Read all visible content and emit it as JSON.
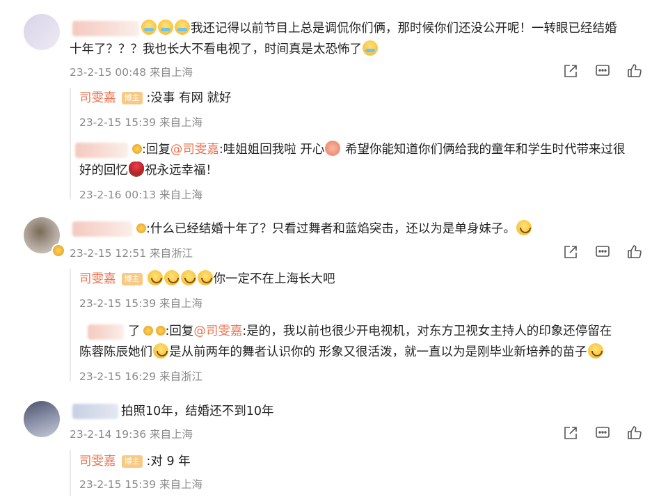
{
  "comments": [
    {
      "text_line1": "我还记得以前节目上总是调侃你们俩，那时候你们还没公开呢！一转眼已经结婚",
      "text_line2": "十年了？？？我也长大不看电视了，时间真是太恐怖了",
      "meta": "23-2-15 00:48 来自上海",
      "reply": {
        "author": "司雯嘉",
        "badge": "博主",
        "text": ":没事 有网 就好",
        "meta": "23-2-15 15:39 来自上海"
      },
      "subreply": {
        "prefix": ":回复",
        "mention": "@司雯嘉",
        "text1a": ":哇姐姐回我啦 开心",
        "text1b": "希望你能知道你们俩给我的童年和学生时代带来过很",
        "text2a": "好的回忆",
        "text2b": "祝永远幸福！",
        "meta": "23-2-16 00:13 来自上海"
      }
    },
    {
      "text": ":什么已经结婚十年了？只看过舞者和蓝焰突击，还以为是单身妹子。",
      "meta": "23-2-15 12:51 来自浙江",
      "reply": {
        "author": "司雯嘉",
        "badge": "博主",
        "text": "你一定不在上海长大吧",
        "meta": "23-2-15 15:39 来自上海"
      },
      "subreply": {
        "name_tail": "了",
        "prefix": ":回复",
        "mention": "@司雯嘉",
        "text1": ":是的，我以前也很少开电视机，对东方卫视女主持人的印象还停留在",
        "text2a": "陈蓉陈辰她们",
        "text2b": "是从前两年的舞者认识你的 形象又很活泼，就一直以为是刚毕业新培养的苗子",
        "meta": "23-2-15 16:29 来自浙江"
      }
    },
    {
      "text": "拍照10年，结婚还不到10年",
      "meta": "23-2-14 19:36 来自上海",
      "reply": {
        "author": "司雯嘉",
        "badge": "博主",
        "text": ":对 9 年",
        "meta": "23-2-15 15:39 来自上海"
      }
    }
  ],
  "icons": [
    "share-icon",
    "comment-icon",
    "like-icon"
  ],
  "colors": {
    "link": "#eb7350",
    "meta": "#8b8b8b",
    "badge": "#f7c983",
    "text": "#222222"
  }
}
